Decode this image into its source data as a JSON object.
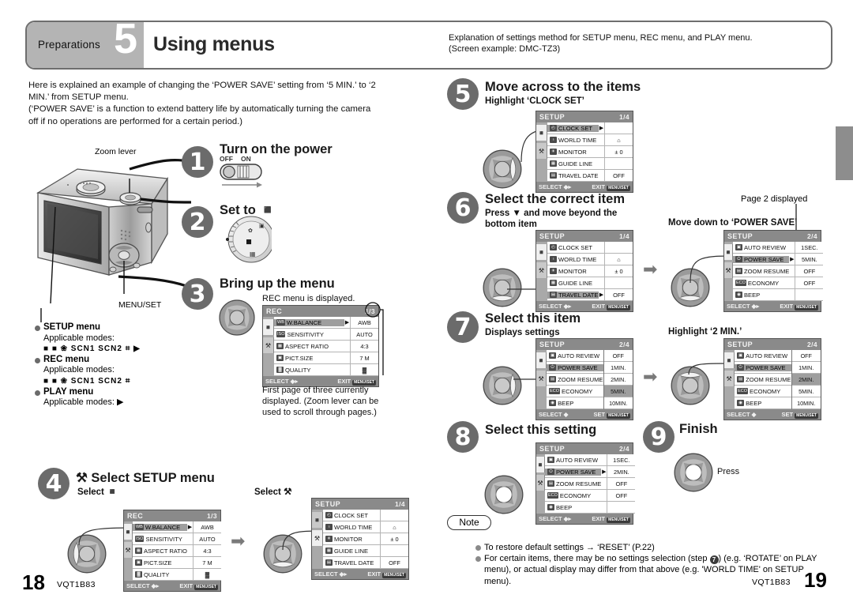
{
  "header": {
    "section_label": "Preparations",
    "section_number": "5",
    "title": "Using menus",
    "explanation_line1": "Explanation of settings method for SETUP menu, REC menu, and PLAY menu.",
    "explanation_line2": "(Screen example: DMC-TZ3)"
  },
  "intro": {
    "line1": "Here is explained an example of changing the ‘POWER SAVE’ setting from ‘5 MIN.’ to ‘2",
    "line2": "MIN.’ from SETUP menu.",
    "line3": "(‘POWER SAVE’ is a function to extend battery life by automatically turning the camera",
    "line4": "off if no operations are performed for a certain period.)"
  },
  "camera": {
    "zoom_lever_label": "Zoom lever",
    "menu_set_label": "MENU/SET",
    "power_off": "OFF",
    "power_on": "ON"
  },
  "steps": {
    "s1": {
      "num": "1",
      "title": "Turn on the power"
    },
    "s2": {
      "num": "2",
      "title": "Set to"
    },
    "s3": {
      "num": "3",
      "title": "Bring up the menu",
      "caption": "REC menu is displayed.",
      "footnote": "First page of three currently displayed. (Zoom lever can be used to scroll through pages.)"
    },
    "s4": {
      "num": "4",
      "title": "Select SETUP menu",
      "sub_left": "Select",
      "sub_right": "Select"
    },
    "s5": {
      "num": "5",
      "title": "Move across to the items",
      "sub": "Highlight ‘CLOCK SET’"
    },
    "s6": {
      "num": "6",
      "title": "Select the correct item",
      "sub": "Press ▼ and move beyond the bottom item",
      "right_caption": "Move down to ‘POWER SAVE’",
      "page2_label": "Page 2 displayed"
    },
    "s7": {
      "num": "7",
      "title": "Select this item",
      "sub": "Displays settings",
      "right_caption": "Highlight ‘2 MIN.’"
    },
    "s8": {
      "num": "8",
      "title": "Select this setting"
    },
    "s9": {
      "num": "9",
      "title": "Finish",
      "press_label": "Press"
    }
  },
  "menus_list": {
    "setup": {
      "head": "SETUP menu",
      "sub": "Applicable modes:",
      "icons": "■ ■ ❀ SCN1 SCN2 ⌗ ▶"
    },
    "rec": {
      "head": "REC menu",
      "sub": "Applicable modes:",
      "icons": "■ ■ ❀ SCN1 SCN2 ⌗"
    },
    "play": {
      "head": "PLAY menu",
      "sub": "Applicable modes:",
      "icons": "▶"
    }
  },
  "lcd": {
    "footer_select": "SELECT",
    "footer_exit": "EXIT",
    "footer_set": "SET",
    "key_menu": "MENU",
    "key_set": "SET",
    "rec_screen": {
      "title": "REC",
      "page": "1/3",
      "rows": [
        {
          "icon": "WB",
          "name": "W.BALANCE",
          "value": "AWB",
          "highlight": true,
          "arrow": "▶"
        },
        {
          "icon": "ISO",
          "name": "SENSITIVITY",
          "value": "AUTO",
          "highlight": false,
          "arrow": ""
        },
        {
          "icon": "▦",
          "name": "ASPECT RATIO",
          "value": "4:3",
          "highlight": false,
          "arrow": ""
        },
        {
          "icon": "▣",
          "name": "PICT.SIZE",
          "value": "7 M",
          "highlight": false,
          "arrow": ""
        },
        {
          "icon": "▓",
          "name": "QUALITY",
          "value": "▓",
          "highlight": false,
          "arrow": ""
        }
      ]
    },
    "setup_p1": {
      "title": "SETUP",
      "page": "1/4",
      "rows": [
        {
          "icon": "◴",
          "name": "CLOCK SET",
          "value": "",
          "highlight": false,
          "arrow": ""
        },
        {
          "icon": "♁",
          "name": "WORLD TIME",
          "value": "⌂",
          "highlight": false,
          "arrow": ""
        },
        {
          "icon": "☀",
          "name": "MONITOR",
          "value": "± 0",
          "highlight": false,
          "arrow": ""
        },
        {
          "icon": "▦",
          "name": "GUIDE LINE",
          "value": "",
          "highlight": false,
          "arrow": ""
        },
        {
          "icon": "▤",
          "name": "TRAVEL DATE",
          "value": "OFF",
          "highlight": false,
          "arrow": ""
        }
      ]
    },
    "setup_p1_clock_hl": {
      "title": "SETUP",
      "page": "1/4",
      "rows": [
        {
          "icon": "◴",
          "name": "CLOCK SET",
          "value": "",
          "highlight": true,
          "arrow": "▶"
        },
        {
          "icon": "♁",
          "name": "WORLD TIME",
          "value": "⌂",
          "highlight": false,
          "arrow": ""
        },
        {
          "icon": "☀",
          "name": "MONITOR",
          "value": "± 0",
          "highlight": false,
          "arrow": ""
        },
        {
          "icon": "▦",
          "name": "GUIDE LINE",
          "value": "",
          "highlight": false,
          "arrow": ""
        },
        {
          "icon": "▤",
          "name": "TRAVEL DATE",
          "value": "OFF",
          "highlight": false,
          "arrow": ""
        }
      ]
    },
    "setup_p1_travel_hl": {
      "title": "SETUP",
      "page": "1/4",
      "rows": [
        {
          "icon": "◴",
          "name": "CLOCK SET",
          "value": "",
          "highlight": false,
          "arrow": ""
        },
        {
          "icon": "♁",
          "name": "WORLD TIME",
          "value": "⌂",
          "highlight": false,
          "arrow": ""
        },
        {
          "icon": "☀",
          "name": "MONITOR",
          "value": "± 0",
          "highlight": false,
          "arrow": ""
        },
        {
          "icon": "▦",
          "name": "GUIDE LINE",
          "value": "",
          "highlight": false,
          "arrow": ""
        },
        {
          "icon": "▤",
          "name": "TRAVEL DATE",
          "value": "OFF",
          "highlight": true,
          "arrow": "▶"
        }
      ]
    },
    "setup_p2_powersave_hl": {
      "title": "SETUP",
      "page": "2/4",
      "rows": [
        {
          "icon": "▣",
          "name": "AUTO REVIEW",
          "value": "1SEC.",
          "highlight": false,
          "arrow": ""
        },
        {
          "icon": "⏻",
          "name": "POWER SAVE",
          "value": "5MIN.",
          "highlight": true,
          "arrow": "▶"
        },
        {
          "icon": "▤",
          "name": "ZOOM RESUME",
          "value": "OFF",
          "highlight": false,
          "arrow": ""
        },
        {
          "icon": "ECO",
          "name": "ECONOMY",
          "value": "OFF",
          "highlight": false,
          "arrow": ""
        },
        {
          "icon": "◉",
          "name": "BEEP",
          "value": "",
          "highlight": false,
          "arrow": ""
        }
      ]
    },
    "setup_p2_options_5min": {
      "title": "SETUP",
      "page": "2/4",
      "rows": [
        {
          "icon": "▣",
          "name": "AUTO REVIEW",
          "highlight": false
        },
        {
          "icon": "⏻",
          "name": "POWER SAVE",
          "highlight": true
        },
        {
          "icon": "▤",
          "name": "ZOOM RESUME",
          "highlight": false
        },
        {
          "icon": "ECO",
          "name": "ECONOMY",
          "highlight": false
        },
        {
          "icon": "◉",
          "name": "BEEP",
          "highlight": false
        }
      ],
      "options": [
        "OFF",
        "1MIN.",
        "2MIN.",
        "5MIN.",
        "10MIN."
      ],
      "selected_option": "5MIN."
    },
    "setup_p2_options_2min": {
      "title": "SETUP",
      "page": "2/4",
      "rows": [
        {
          "icon": "▣",
          "name": "AUTO REVIEW",
          "highlight": false
        },
        {
          "icon": "⏻",
          "name": "POWER SAVE",
          "highlight": true
        },
        {
          "icon": "▤",
          "name": "ZOOM RESUME",
          "highlight": false
        },
        {
          "icon": "ECO",
          "name": "ECONOMY",
          "highlight": false
        },
        {
          "icon": "◉",
          "name": "BEEP",
          "highlight": false
        }
      ],
      "options": [
        "OFF",
        "1MIN.",
        "2MIN.",
        "5MIN.",
        "10MIN."
      ],
      "selected_option": "2MIN."
    },
    "setup_p2_2min_set": {
      "title": "SETUP",
      "page": "2/4",
      "rows": [
        {
          "icon": "▣",
          "name": "AUTO REVIEW",
          "value": "1SEC.",
          "highlight": false,
          "arrow": ""
        },
        {
          "icon": "⏻",
          "name": "POWER SAVE",
          "value": "2MIN.",
          "highlight": true,
          "arrow": "▶"
        },
        {
          "icon": "▤",
          "name": "ZOOM RESUME",
          "value": "OFF",
          "highlight": false,
          "arrow": ""
        },
        {
          "icon": "ECO",
          "name": "ECONOMY",
          "value": "OFF",
          "highlight": false,
          "arrow": ""
        },
        {
          "icon": "◉",
          "name": "BEEP",
          "value": "",
          "highlight": false,
          "arrow": ""
        }
      ]
    }
  },
  "note": {
    "label": "Note",
    "item1": "To restore default settings → ‘RESET’ (P.22)",
    "item2_a": "For certain items, there may be no settings selection (step ",
    "item2_num": "7",
    "item2_b": ") (e.g. ‘ROTATE’ on PLAY menu), or actual display may differ from that above (e.g. 'WORLD TIME' on SETUP menu)."
  },
  "footer": {
    "left_page": "18",
    "left_code": "VQT1B83",
    "right_code": "VQT1B83",
    "right_page": "19"
  }
}
